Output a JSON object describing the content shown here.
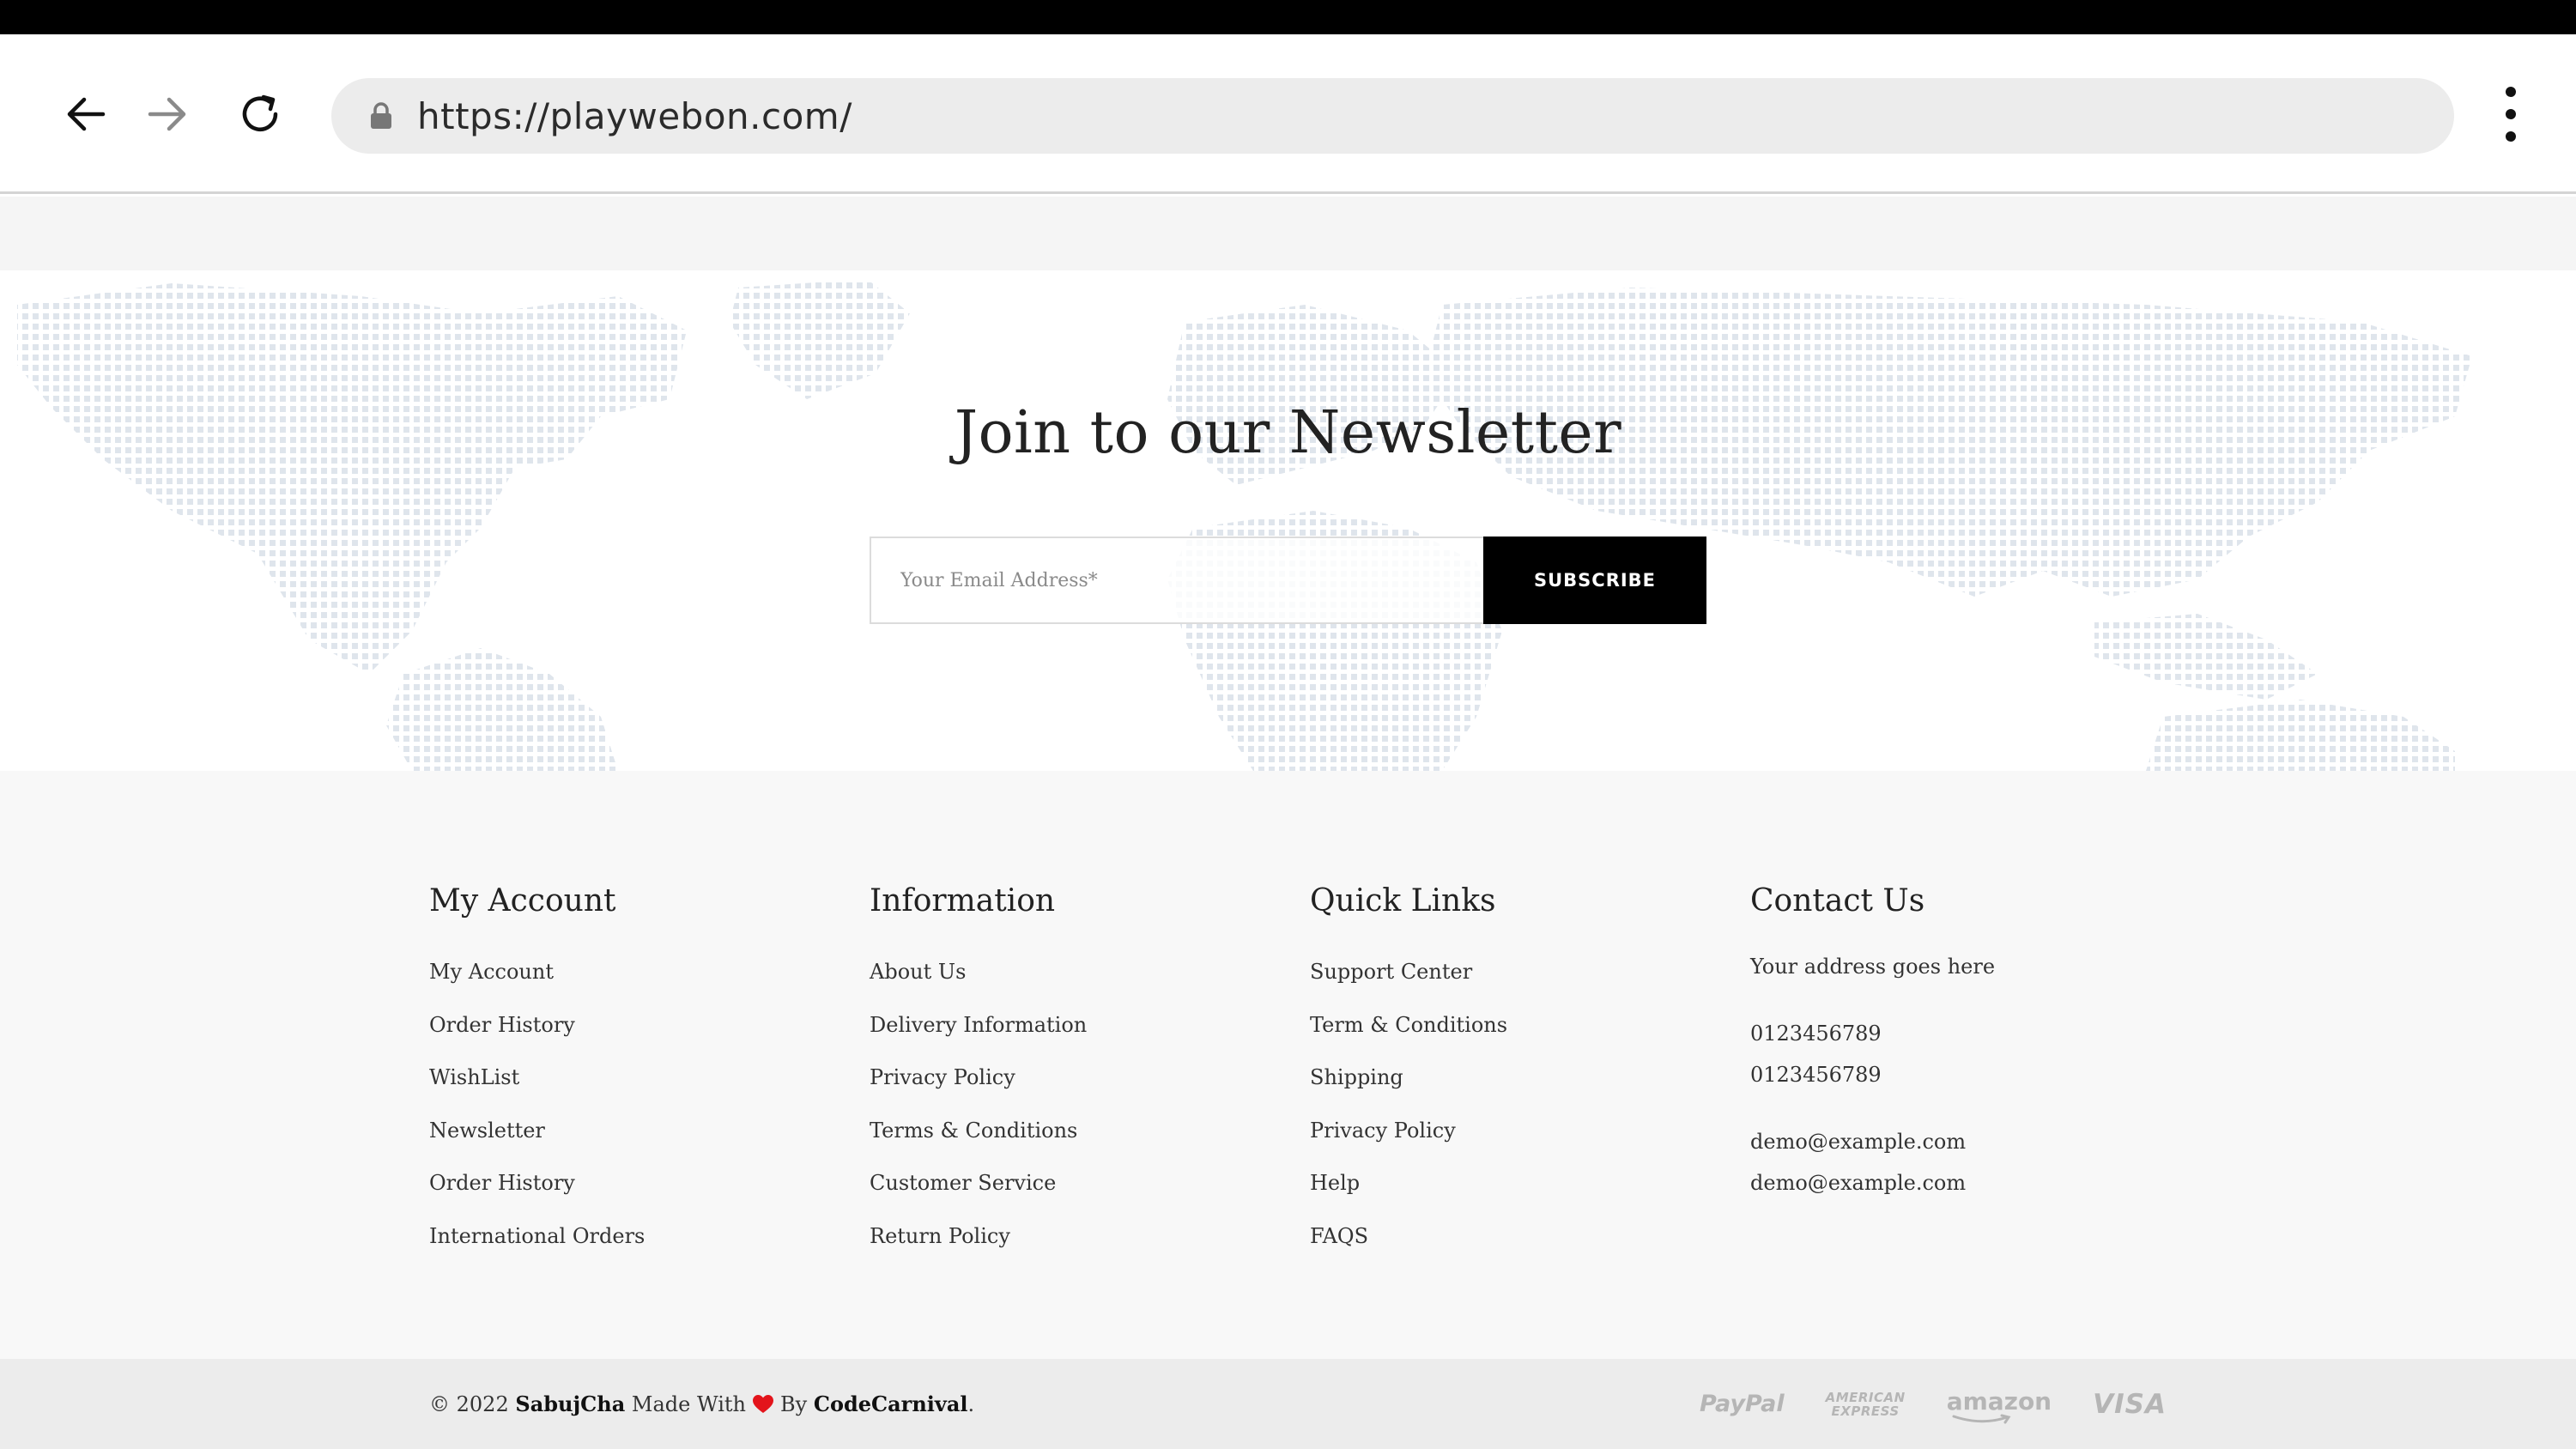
{
  "browser": {
    "url": "https://playwebon.com/"
  },
  "newsletter": {
    "title": "Join to our Newsletter",
    "email_placeholder": "Your Email Address*",
    "subscribe_label": "Subscribe"
  },
  "footer": {
    "columns": [
      {
        "title": "My Account",
        "links": [
          "My Account",
          "Order History",
          "WishList",
          "Newsletter",
          "Order History",
          "International Orders"
        ]
      },
      {
        "title": "Information",
        "links": [
          "About Us",
          "Delivery Information",
          "Privacy Policy",
          "Terms & Conditions",
          "Customer Service",
          "Return Policy"
        ]
      },
      {
        "title": "Quick Links",
        "links": [
          "Support Center",
          "Term & Conditions",
          "Shipping",
          "Privacy Policy",
          "Help",
          "FAQS"
        ]
      }
    ],
    "contact": {
      "title": "Contact Us",
      "address": "Your address goes here",
      "phones": [
        "0123456789",
        "0123456789"
      ],
      "emails": [
        "demo@example.com",
        "demo@example.com"
      ]
    }
  },
  "copyright": {
    "prefix": "© 2022",
    "brand": "SabujCha",
    "made_with": "Made With",
    "by": "By",
    "author": "CodeCarnival",
    "suffix": "."
  },
  "payments": {
    "paypal": "PayPal",
    "amex_line1": "AMERICAN",
    "amex_line2": "EXPRESS",
    "amazon": "amazon",
    "visa": "VISA"
  },
  "colors": {
    "accent": "#000000",
    "heart": "#e3141b",
    "footer_bg": "#f8f8f8",
    "copyright_bg": "#ececec"
  }
}
